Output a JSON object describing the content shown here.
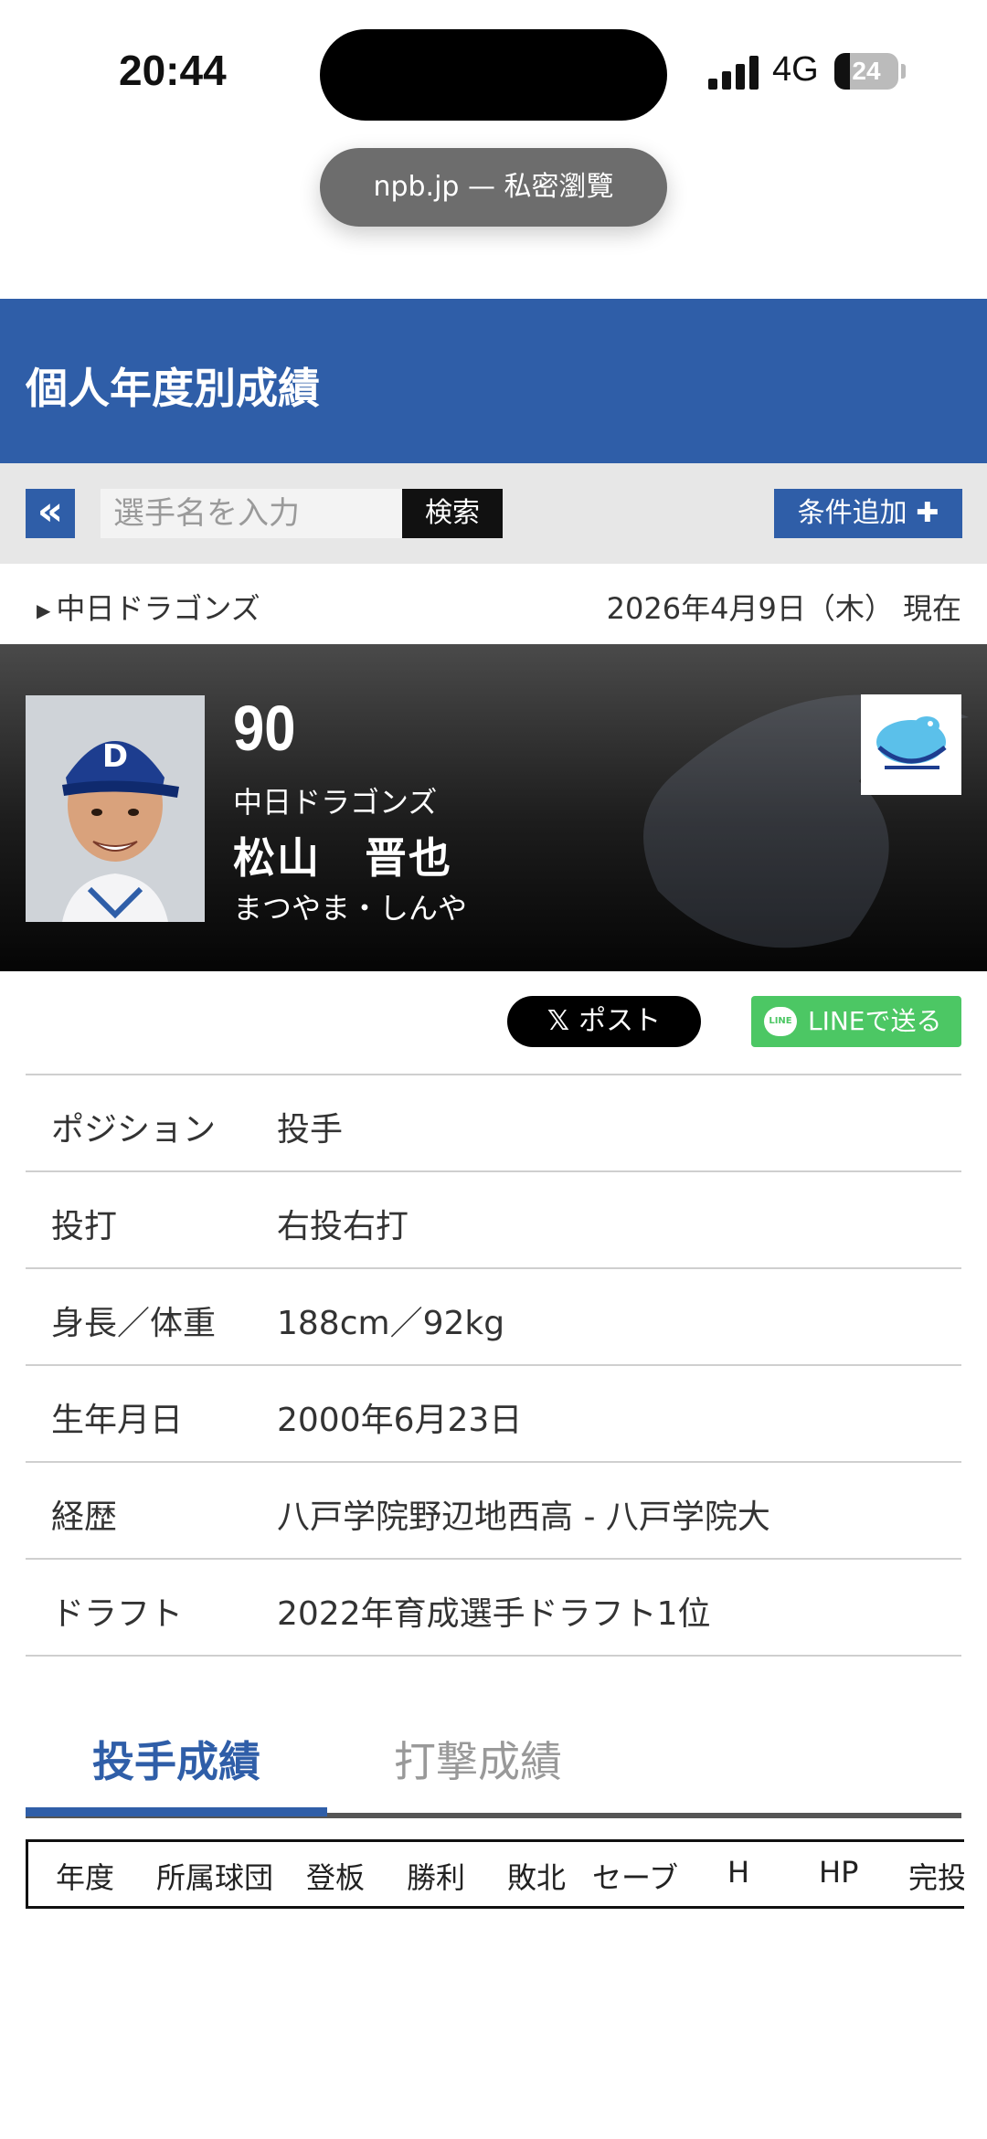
{
  "status_bar": {
    "time": "20:44",
    "network": "4G",
    "battery": "24",
    "battery_level": 0.24
  },
  "browser": {
    "url_label": "npb.jp — 私密瀏覽"
  },
  "header": {
    "title": "個人年度別成績"
  },
  "search": {
    "back_icon": "«",
    "placeholder": "選手名を入力",
    "search_label": "検索",
    "add_condition_label": "条件追加 ✚"
  },
  "team_row": {
    "team_link": "中日ドラゴンズ",
    "date": "2026年4月9日（木） 現在"
  },
  "player": {
    "uniform_number": "90",
    "team": "中日ドラゴンズ",
    "name": "松山　晋也",
    "kana": "まつやま・しんや"
  },
  "share": {
    "x_icon": "𝕏",
    "x_label": "ポスト",
    "line_icon": "LINE",
    "line_label": "LINEで送る"
  },
  "profile": [
    {
      "key": "ポジション",
      "value": "投手"
    },
    {
      "key": "投打",
      "value": "右投右打"
    },
    {
      "key": "身長／体重",
      "value": "188cm／92kg"
    },
    {
      "key": "生年月日",
      "value": "2000年6月23日"
    },
    {
      "key": "経歴",
      "value": "八戸学院野辺地西高 - 八戸学院大"
    },
    {
      "key": "ドラフト",
      "value": "2022年育成選手ドラフト1位"
    }
  ],
  "tabs": {
    "pitching": "投手成績",
    "batting": "打撃成績"
  },
  "stats_columns": [
    "年度",
    "所属球団",
    "登板",
    "勝利",
    "敗北",
    "セーブ",
    "H",
    "HP",
    "完投"
  ],
  "colors": {
    "brand_blue": "#2f5ea8",
    "line_green": "#4cc764"
  }
}
